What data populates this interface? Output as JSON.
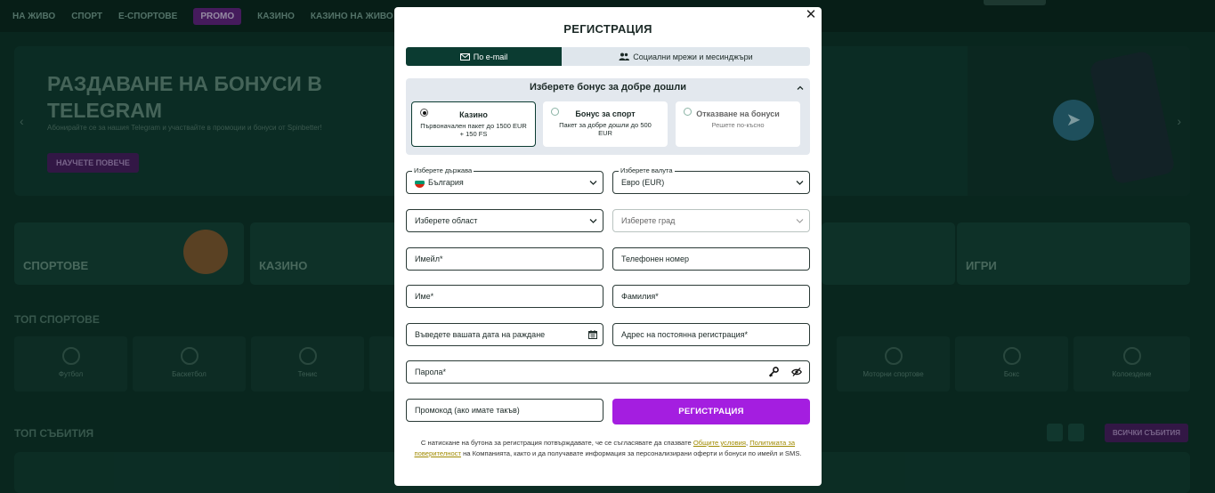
{
  "background": {
    "nav": [
      "НА ЖИВО",
      "СПОРТ",
      "Е-СПОРТОВЕ",
      "PROMO",
      "КАЗИНО",
      "КАЗИНО НА ЖИВО"
    ],
    "hero": {
      "title": "РАЗДАВАНЕ НА БОНУСИ В TELEGRAM",
      "subtitle": "Абонирайте се за нашия Telegram и участвайте в промоции и бонуси от Spinbetter!",
      "button": "НАУЧЕТЕ ПОВЕЧЕ"
    },
    "categories": [
      "СПОРТОВЕ",
      "КАЗИНО",
      "ИГРИ"
    ],
    "top_sports_title": "ТОП СПОРТОВЕ",
    "sports": [
      "Футбол",
      "Баскетбол",
      "Тенис",
      "Моторни спортове",
      "Бокс",
      "Колоездене"
    ],
    "top_events_title": "ТОП СЪБИТИЯ",
    "all_events": "ВСИЧКИ СЪБИТИЯ"
  },
  "modal": {
    "title": "РЕГИСТРАЦИЯ",
    "close_glyph": "✕",
    "tabs": [
      {
        "label": "По e-mail",
        "active": true
      },
      {
        "label": "Социални мрежи и месинджъри",
        "active": false
      }
    ],
    "bonus": {
      "heading": "Изберете бонус за добре дошли",
      "options": [
        {
          "title": "Казино",
          "desc": "Първоначален пакет до 1500 EUR + 150 FS",
          "selected": true
        },
        {
          "title": "Бонус за спорт",
          "desc": "Пакет за добре дошли до 500 EUR",
          "selected": false
        },
        {
          "title": "Отказване на бонуси",
          "desc": "Решете по-късно",
          "selected": false
        }
      ]
    },
    "fields": {
      "country_label": "Изберете държава",
      "country_value": "България",
      "currency_label": "Изберете валута",
      "currency_value": "Евро (EUR)",
      "region": "Изберете област",
      "city": "Изберете град",
      "email": "Имейл*",
      "phone": "Телефонен номер",
      "first_name": "Име*",
      "last_name": "Фамилия*",
      "birth_date": "Въведете вашата дата на раждане",
      "address": "Адрес на постоянна регистрация*",
      "password": "Парола*",
      "promo": "Промокод (ако имате такъв)"
    },
    "submit": "РЕГИСТРАЦИЯ",
    "legal": {
      "part1": "С натискане на бутона за регистрация потвърждавате, че се съгласявате да спазвате ",
      "terms": "Общите условия",
      "sep": ", ",
      "privacy": "Политиката за поверителност",
      "part2": " на Компанията, както и да получавате информация за персонализирани оферти и бонуси по имейл и SMS."
    },
    "colors": {
      "accent": "#a41ee0",
      "tab_active": "#0b3b31",
      "link": "#a08a00"
    }
  }
}
